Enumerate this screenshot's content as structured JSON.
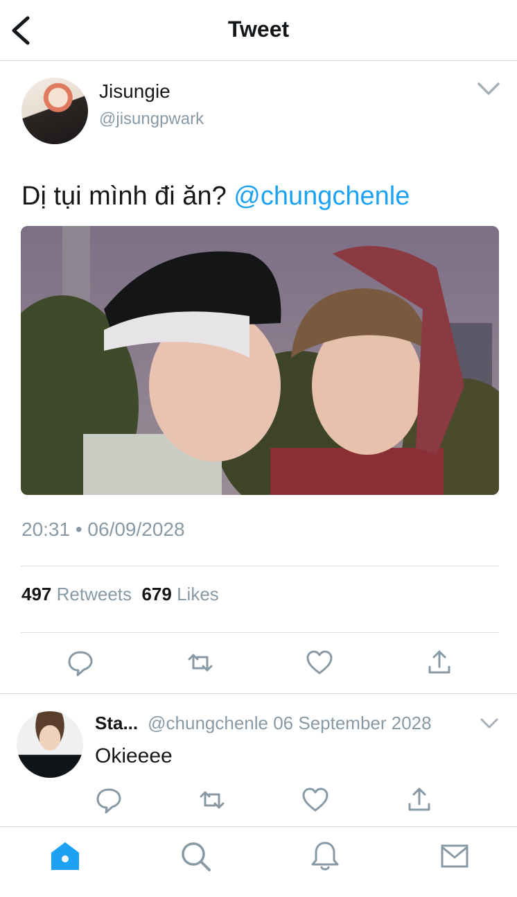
{
  "header": {
    "title": "Tweet"
  },
  "tweet": {
    "author_name": "Jisungie",
    "author_handle": "@jisungpwark",
    "text": "Dị tụi mình đi ăn? ",
    "mention": "@chungchenle",
    "timestamp": "20:31 • 06/09/2028",
    "retweets_count": "497",
    "retweets_label": "Retweets",
    "likes_count": "679",
    "likes_label": "Likes"
  },
  "reply": {
    "name": "Sta...",
    "handle_date": "@chungchenle 06 September 2028",
    "text": "Okieeee"
  },
  "icons": {
    "back": "chevron-left-icon",
    "caret": "chevron-down-icon",
    "reply": "speech-bubble-icon",
    "retweet": "retweet-icon",
    "like": "heart-icon",
    "share": "share-icon",
    "home": "home-icon",
    "search": "search-icon",
    "notifications": "bell-icon",
    "messages": "envelope-icon"
  },
  "colors": {
    "accent": "#1da1f2",
    "muted": "#8899a6",
    "text": "#14171a"
  }
}
